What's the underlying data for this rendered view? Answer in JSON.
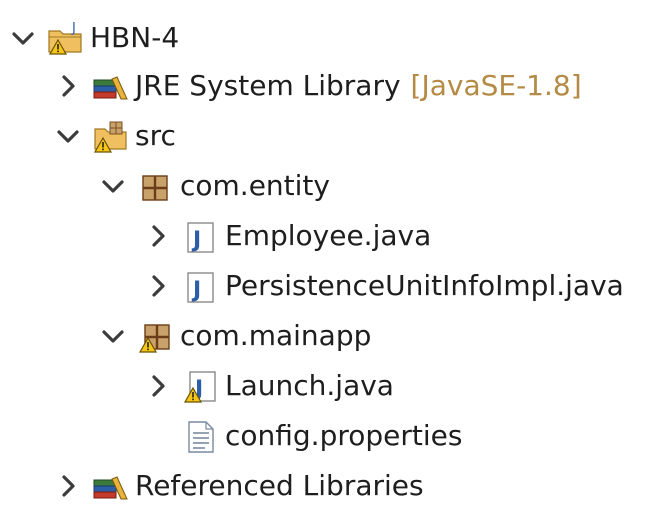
{
  "project": {
    "label": "HBN-4",
    "icon": "java-project-icon",
    "expanded": true,
    "children": {
      "jre": {
        "label": "JRE System Library",
        "decoration": "[JavaSE-1.8]",
        "icon": "library-icon",
        "expanded": false
      },
      "src": {
        "label": "src",
        "icon": "source-folder-icon",
        "expanded": true,
        "packages": {
          "entity": {
            "label": "com.entity",
            "icon": "package-icon",
            "expanded": true,
            "files": [
              {
                "label": "Employee.java",
                "icon": "java-file-icon"
              },
              {
                "label": "PersistenceUnitInfoImpl.java",
                "icon": "java-file-icon"
              }
            ]
          },
          "mainapp": {
            "label": "com.mainapp",
            "icon": "package-warning-icon",
            "expanded": true,
            "files": [
              {
                "label": "Launch.java",
                "icon": "java-file-warning-icon"
              }
            ]
          }
        },
        "config": {
          "label": "config.properties",
          "icon": "properties-file-icon"
        }
      },
      "reflibs": {
        "label": "Referenced Libraries",
        "icon": "library-icon",
        "expanded": false
      }
    }
  },
  "colors": {
    "text": "#1e1e1e",
    "decoration": "#b48a45",
    "chevron": "#3c3c3c",
    "warning": "#f5c518",
    "java_blue": "#2c5ea8",
    "package_brown": "#a0522d"
  }
}
